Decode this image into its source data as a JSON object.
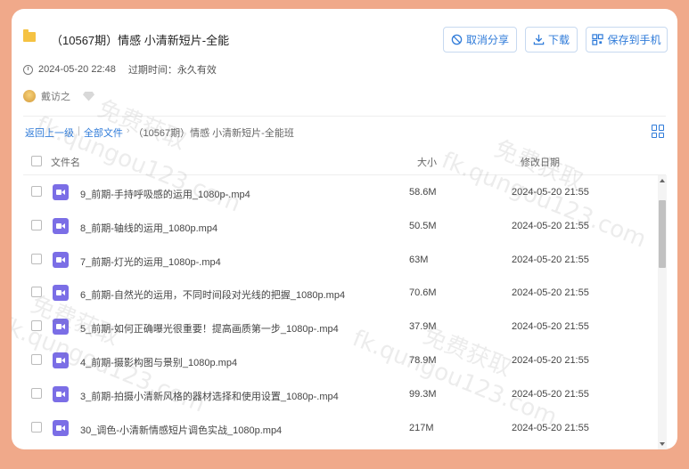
{
  "header": {
    "title": "（10567期）情感 小清新短片-全能...",
    "buttons": {
      "cancel_share": "取消分享",
      "download": "下载",
      "save_to_phone": "保存到手机"
    }
  },
  "meta": {
    "created": "2024-05-20 22:48",
    "expire_label": "过期时间：永久有效"
  },
  "user": {
    "name": "戴访之"
  },
  "breadcrumb": {
    "back": "返回上一级",
    "all_files": "全部文件",
    "separator": "|",
    "arrow": "›",
    "current": "（10567期）情感 小清新短片-全能班"
  },
  "table": {
    "columns": {
      "name": "文件名",
      "size": "大小",
      "date": "修改日期"
    },
    "rows": [
      {
        "name": "9_前期-手持呼吸感的运用_1080p-.mp4",
        "size": "58.6M",
        "date": "2024-05-20 21:55"
      },
      {
        "name": "8_前期-轴线的运用_1080p.mp4",
        "size": "50.5M",
        "date": "2024-05-20 21:55"
      },
      {
        "name": "7_前期-灯光的运用_1080p-.mp4",
        "size": "63M",
        "date": "2024-05-20 21:55"
      },
      {
        "name": "6_前期-自然光的运用，不同时间段对光线的把握_1080p.mp4",
        "size": "70.6M",
        "date": "2024-05-20 21:55"
      },
      {
        "name": "5_前期-如何正确曝光很重要！提高画质第一步_1080p-.mp4",
        "size": "37.9M",
        "date": "2024-05-20 21:55"
      },
      {
        "name": "4_前期-摄影构图与景别_1080p.mp4",
        "size": "78.9M",
        "date": "2024-05-20 21:55"
      },
      {
        "name": "3_前期-拍摄小清新风格的器材选择和使用设置_1080p-.mp4",
        "size": "99.3M",
        "date": "2024-05-20 21:55"
      },
      {
        "name": "30_调色-小清新情感短片调色实战_1080p.mp4",
        "size": "217M",
        "date": "2024-05-20 21:55"
      }
    ]
  },
  "watermarks": [
    "免费获取",
    "fk.qungou123.com"
  ],
  "colors": {
    "background": "#f0a98a",
    "accent": "#2f7bd9",
    "video_icon": "#7b6ee6",
    "folder_icon": "#f5c242"
  },
  "icons": {
    "folder": "folder-icon",
    "video": "video-file-icon",
    "cancel": "cancel-share-icon",
    "download": "download-icon",
    "save": "qr-phone-icon",
    "view": "grid-view-icon"
  }
}
